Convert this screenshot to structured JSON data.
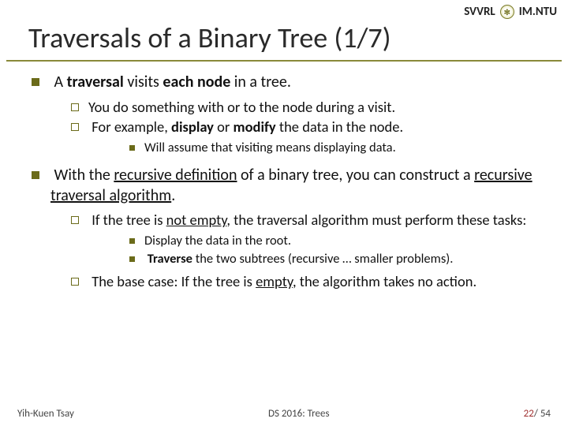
{
  "header": {
    "left": "SVVRL",
    "at": "@",
    "right": "IM.NTU"
  },
  "title": "Traversals of a Binary Tree (1/7)",
  "b1": {
    "pre": "A ",
    "bold": "traversal",
    "mid": " visits ",
    "bold2": "each node",
    "post": " in a tree."
  },
  "b1a": "You do something with or to the node during a visit.",
  "b1b": {
    "pre": "For example, ",
    "bold": "display",
    "mid": " or ",
    "bold2": "modify",
    "post": " the data in the node."
  },
  "b1b1": "Will assume that visiting means displaying data.",
  "b2": {
    "pre": "With the ",
    "u1": "recursive definition",
    "mid": " of a binary tree, you can construct a ",
    "u2": "recursive traversal algorithm",
    "post": "."
  },
  "b2a": {
    "pre": "If the tree is ",
    "u": "not empty",
    "post": ", the traversal algorithm must perform these tasks:"
  },
  "b2a1": "Display the data in the root.",
  "b2a2": {
    "bold": "Traverse",
    "post": " the two subtrees (recursive … smaller problems)."
  },
  "b2b": {
    "pre": "The base case: If the tree is ",
    "u": "empty",
    "post": ", the algorithm takes no action."
  },
  "footer": {
    "author": "Yih-Kuen Tsay",
    "course": "DS 2016: Trees",
    "page_current": "22",
    "page_sep": "/ ",
    "page_total": "54"
  }
}
